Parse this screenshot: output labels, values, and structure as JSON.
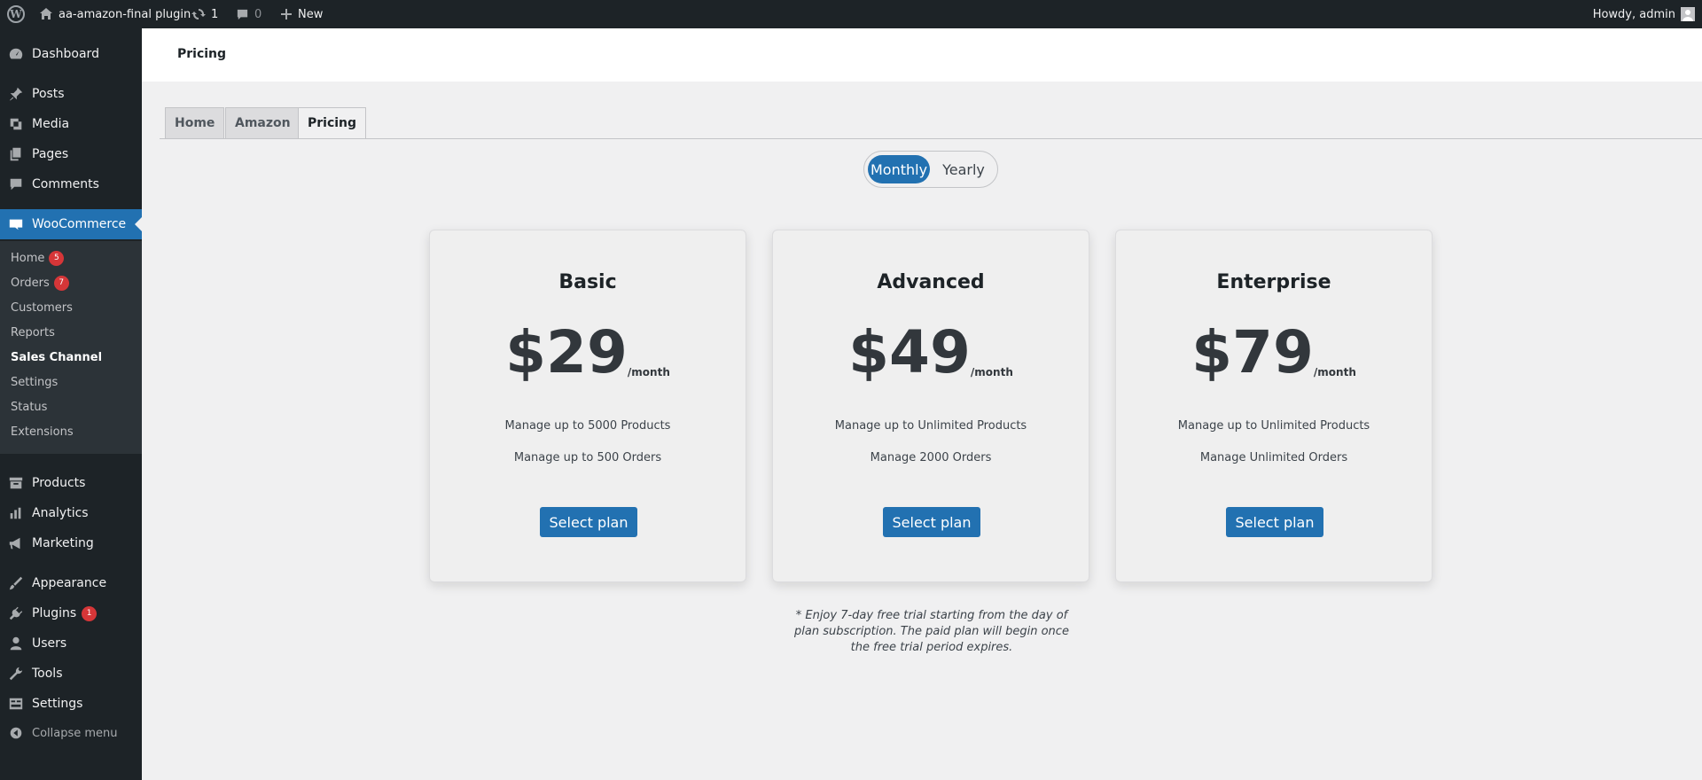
{
  "adminbar": {
    "site_name": "aa-amazon-final plugin",
    "updates_count": "1",
    "comments_count": "0",
    "new_label": "New",
    "howdy": "Howdy, admin"
  },
  "sidebar": {
    "items_top": [
      {
        "label": "Dashboard",
        "icon": "dashboard-icon"
      },
      {
        "label": "Posts",
        "icon": "pin-icon"
      },
      {
        "label": "Media",
        "icon": "media-icon"
      },
      {
        "label": "Pages",
        "icon": "pages-icon"
      },
      {
        "label": "Comments",
        "icon": "comment-icon"
      },
      {
        "label": "WooCommerce",
        "icon": "woo-icon"
      }
    ],
    "submenu": [
      {
        "label": "Home",
        "badge": "5"
      },
      {
        "label": "Orders",
        "badge": "7"
      },
      {
        "label": "Customers"
      },
      {
        "label": "Reports"
      },
      {
        "label": "Sales Channel"
      },
      {
        "label": "Settings"
      },
      {
        "label": "Status"
      },
      {
        "label": "Extensions"
      }
    ],
    "items_bottom": [
      {
        "label": "Products",
        "icon": "archive-icon"
      },
      {
        "label": "Analytics",
        "icon": "bar-chart-icon"
      },
      {
        "label": "Marketing",
        "icon": "megaphone-icon"
      },
      {
        "label": "Appearance",
        "icon": "brush-icon"
      },
      {
        "label": "Plugins",
        "icon": "plug-icon",
        "badge": "1"
      },
      {
        "label": "Users",
        "icon": "user-icon"
      },
      {
        "label": "Tools",
        "icon": "wrench-icon"
      },
      {
        "label": "Settings",
        "icon": "settings-icon"
      },
      {
        "label": "Collapse menu",
        "icon": "collapse-icon"
      }
    ]
  },
  "header": {
    "title": "Pricing"
  },
  "tabs": [
    "Home",
    "Amazon",
    "Pricing"
  ],
  "toggle": {
    "monthly": "Monthly",
    "yearly": "Yearly"
  },
  "plans": [
    {
      "name": "Basic",
      "price": "$29",
      "period": "/month",
      "features": [
        "Manage up to 5000 Products",
        "Manage up to 500 Orders"
      ],
      "button": "Select plan"
    },
    {
      "name": "Advanced",
      "price": "$49",
      "period": "/month",
      "features": [
        "Manage up to Unlimited Products",
        "Manage 2000 Orders"
      ],
      "button": "Select plan"
    },
    {
      "name": "Enterprise",
      "price": "$79",
      "period": "/month",
      "features": [
        "Manage up to Unlimited Products",
        "Manage Unlimited Orders"
      ],
      "button": "Select plan"
    }
  ],
  "note": "* Enjoy 7-day free trial starting from the day of plan subscription. The paid plan will begin once the free trial period expires.",
  "colors": {
    "accent": "#2271b1",
    "sidebar_bg": "#1d2327",
    "badge": "#d63638"
  }
}
